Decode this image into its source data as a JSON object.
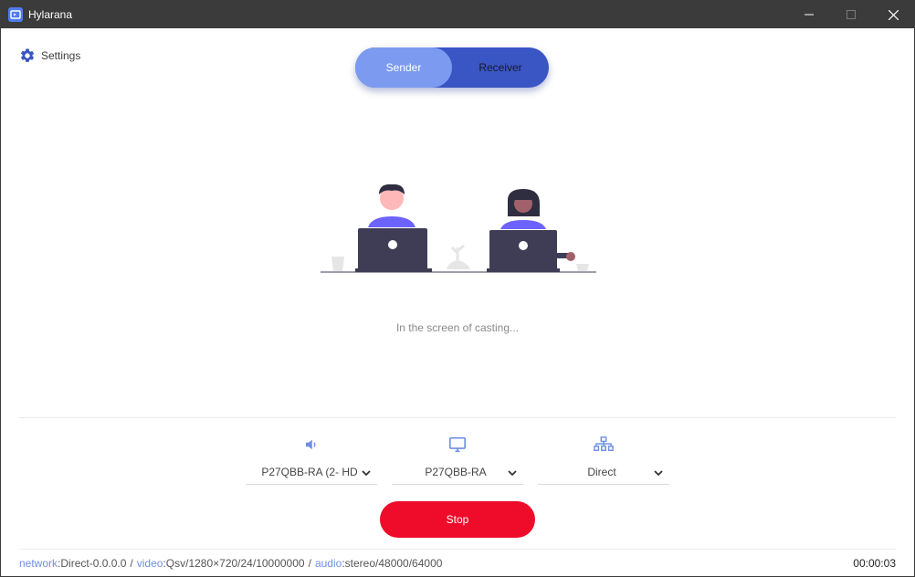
{
  "window": {
    "title": "Hylarana"
  },
  "settings": {
    "label": "Settings"
  },
  "mode_toggle": {
    "sender_label": "Sender",
    "receiver_label": "Receiver",
    "active": "Sender"
  },
  "status": {
    "text": "In the screen of casting..."
  },
  "selectors": {
    "audio": {
      "icon": "speaker-icon",
      "value": "P27QBB-RA (2- HD"
    },
    "video": {
      "icon": "monitor-icon",
      "value": "P27QBB-RA"
    },
    "network": {
      "icon": "network-icon",
      "value": "Direct"
    }
  },
  "stop_button": {
    "label": "Stop"
  },
  "footer": {
    "network_key": "network",
    "network_value": "Direct-0.0.0.0",
    "video_key": "video",
    "video_value": "Qsv/1280×720/24/10000000",
    "audio_key": "audio",
    "audio_value": "stereo/48000/64000",
    "separator": "/",
    "timer": "00:00:03"
  },
  "colors": {
    "accent": "#4f6fe0",
    "toggle_dark": "#3a55c4",
    "toggle_light": "#7c9bf0",
    "stop": "#ee0c2a",
    "titlebar": "#3b3b3b",
    "footer_key": "#6e8fe6"
  }
}
